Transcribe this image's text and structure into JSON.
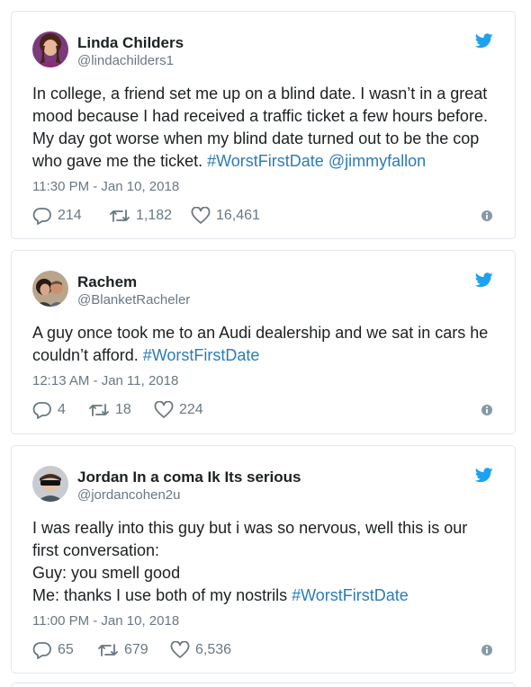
{
  "tweets": [
    {
      "name": "Linda Childers",
      "handle": "@lindachilders1",
      "text_lines": [
        [
          {
            "t": "In college, a friend set me up on a blind date. I wasn’t in a great"
          }
        ],
        [
          {
            "t": "mood because I had received a traffic ticket a few hours before."
          }
        ],
        [
          {
            "t": "My day got worse when my blind date turned out to be the cop"
          }
        ],
        [
          {
            "t": "who gave me the ticket. "
          },
          {
            "t": "#WorstFirstDate",
            "link": true
          },
          {
            "t": " "
          },
          {
            "t": "@jimmyfallon",
            "link": true
          }
        ]
      ],
      "timestamp": "11:30 PM - Jan 10, 2018",
      "replies": "214",
      "retweets": "1,182",
      "likes": "16,461",
      "avatar_icon": "avatar-woman-photo"
    },
    {
      "name": "Rachem",
      "handle": "@BlanketRacheler",
      "text_lines": [
        [
          {
            "t": "A guy once took me to an Audi dealership and we sat in cars he"
          }
        ],
        [
          {
            "t": "couldn’t afford. "
          },
          {
            "t": "#WorstFirstDate",
            "link": true
          }
        ]
      ],
      "timestamp": "12:13 AM - Jan 11, 2018",
      "replies": "4",
      "retweets": "18",
      "likes": "224",
      "avatar_icon": "avatar-couple-photo"
    },
    {
      "name": "Jordan In a coma Ik Its serious",
      "handle": "@jordancohen2u",
      "text_lines": [
        [
          {
            "t": "I was really into this guy but i was so nervous, well this is our"
          }
        ],
        [
          {
            "t": "first conversation:"
          }
        ],
        [
          {
            "t": "Guy: you smell good"
          }
        ],
        [
          {
            "t": "Me: thanks I use both of my nostrils  "
          },
          {
            "t": "#WorstFirstDate",
            "link": true
          }
        ]
      ],
      "timestamp": "11:00 PM - Jan 10, 2018",
      "replies": "65",
      "retweets": "679",
      "likes": "6,536",
      "avatar_icon": "avatar-masked-photo"
    }
  ],
  "colors": {
    "link": "#2b7bb9",
    "twitter_blue": "#1da1f2",
    "meta_gray": "#697882",
    "border": "#e1e8ed"
  },
  "icons": {
    "brand": "twitter-bird-icon",
    "reply": "reply-icon",
    "retweet": "retweet-icon",
    "like": "heart-icon",
    "info": "info-icon"
  }
}
